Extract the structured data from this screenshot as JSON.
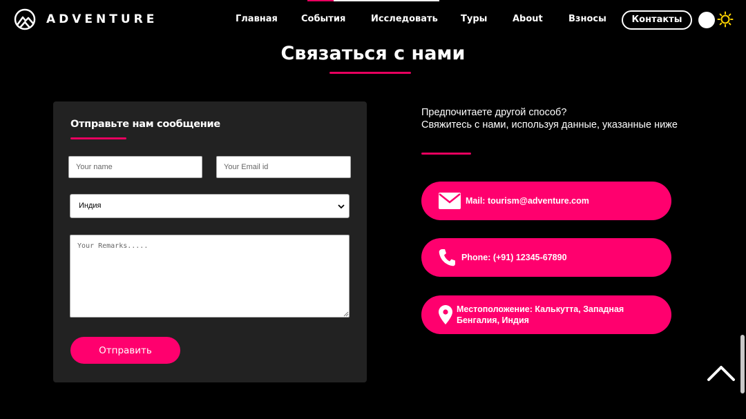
{
  "header": {
    "logo_text": "ADVENTURE",
    "nav": [
      "Главная",
      "События",
      "Исследовать",
      "Туры",
      "About",
      "Взносы"
    ],
    "contacts_button": "Контакты",
    "scroll_progress_percent": 20
  },
  "page": {
    "title": "Связаться с нами"
  },
  "form": {
    "heading": "Отправьте нам сообщение",
    "name_placeholder": "Your name",
    "email_placeholder": "Your Email id",
    "country_selected": "Индия",
    "remarks_placeholder": "Your Remarks.....",
    "submit_label": "Отправить"
  },
  "contact": {
    "intro_line1": "Предпочитаете другой способ?",
    "intro_line2": "Свяжитесь с нами, используя данные, указанные ниже",
    "mail": "Mail: tourism@adventure.com",
    "phone": "Phone: (+91) 12345-67890",
    "location": "Местоположение: Калькутта, Западная Бенгалия, Индия"
  },
  "colors": {
    "accent": "#ff006e",
    "background": "#000000",
    "card": "#222222"
  },
  "icons": [
    "mountain-logo-icon",
    "sun-icon",
    "mail-icon",
    "phone-icon",
    "location-pin-icon",
    "chevron-up-icon",
    "chevron-down-icon"
  ]
}
